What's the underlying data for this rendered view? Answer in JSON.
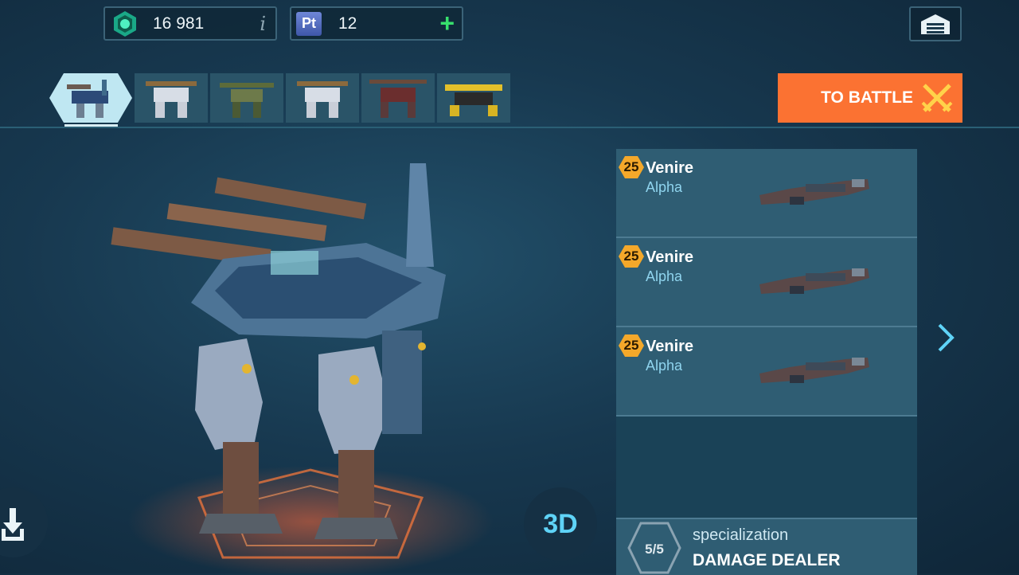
{
  "currency": {
    "silver": "16 981",
    "silver_info": "i",
    "platinum_badge": "Pt",
    "platinum": "12",
    "platinum_add": "+"
  },
  "robot_tabs": [
    {
      "name": "robot-tab-1",
      "active": true
    },
    {
      "name": "robot-tab-2",
      "active": false
    },
    {
      "name": "robot-tab-3",
      "active": false
    },
    {
      "name": "robot-tab-4",
      "active": false
    },
    {
      "name": "robot-tab-5",
      "active": false
    },
    {
      "name": "robot-tab-6",
      "active": false
    }
  ],
  "battle_button": {
    "label": "TO BATTLE",
    "icon": "crossed-swords-icon"
  },
  "weapons": [
    {
      "level": "25",
      "name": "Venire",
      "subtitle": "Alpha"
    },
    {
      "level": "25",
      "name": "Venire",
      "subtitle": "Alpha"
    },
    {
      "level": "25",
      "name": "Venire",
      "subtitle": "Alpha"
    }
  ],
  "specialization": {
    "count": "5/5",
    "label": "specialization",
    "value": "DAMAGE DEALER"
  },
  "view_3d_label": "3D",
  "colors": {
    "accent_orange": "#fb7232",
    "panel_blue": "#2f5d73",
    "level_gold": "#f4a82a",
    "cyan_text": "#5fd3f7"
  }
}
